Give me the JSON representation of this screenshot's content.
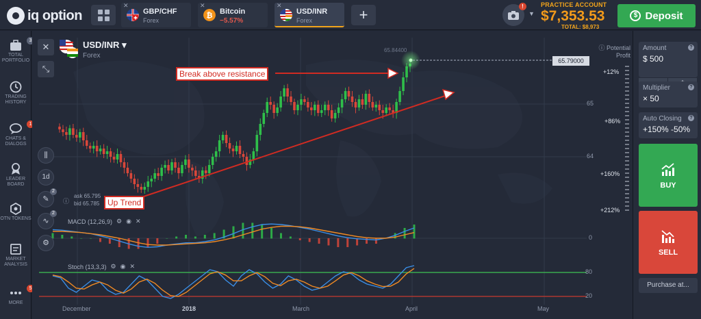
{
  "brand": {
    "name": "iq option"
  },
  "tabs": [
    {
      "name": "GBP/CHF",
      "sub": "Forex"
    },
    {
      "name": "Bitcoin",
      "sub": "−5.57%"
    },
    {
      "name": "USD/INR",
      "sub": "Forex"
    }
  ],
  "account": {
    "label": "PRACTICE ACCOUNT",
    "balance": "$7,353.53",
    "total": "TOTAL: $8,973",
    "notification_badge": "!"
  },
  "deposit_label": "Deposit",
  "sidebar": [
    {
      "label": "TOTAL PORTFOLIO",
      "badge": "3",
      "icon": "portfolio-icon"
    },
    {
      "label": "TRADING HISTORY",
      "badge": "",
      "icon": "history-icon"
    },
    {
      "label": "CHATS & DIALOGS",
      "badge": "1",
      "icon": "chat-icon"
    },
    {
      "label": "LEADER BOARD",
      "badge": "",
      "icon": "leaderboard-icon"
    },
    {
      "label": "OTN TOKENS",
      "badge": "",
      "icon": "token-icon"
    },
    {
      "label": "MARKET ANALYSIS",
      "badge": "",
      "icon": "market-analysis-icon"
    },
    {
      "label": "MORE",
      "badge": "5",
      "icon": "more-icon"
    }
  ],
  "instrument": {
    "pair": "USD/INR",
    "type": "Forex"
  },
  "chart": {
    "potential_profit_label": "Potential Profit",
    "current_price": "65.79000",
    "high_marker": "65.84400",
    "ask": "ask 65.795",
    "bid": "bid 65.785",
    "timeframe": "1d",
    "tool_badges": [
      "2",
      "2"
    ],
    "annotations": [
      "Break above resistance",
      "Up Trend"
    ],
    "macd_label": "MACD (12,26,9)",
    "stoch_label": "Stoch (13,3,3)",
    "price_axis": [
      "65",
      "64"
    ],
    "macd_axis": [
      "0"
    ],
    "stoch_axis": [
      "80",
      "20"
    ],
    "profit_levels": [
      "+12%",
      "+86%",
      "+160%",
      "+212%"
    ],
    "time_axis": [
      "December",
      "2018",
      "March",
      "April",
      "May"
    ]
  },
  "chart_data": {
    "type": "candlestick",
    "ylim": [
      63.4,
      65.9
    ],
    "candles_close": [
      64.6,
      64.55,
      64.5,
      64.62,
      64.5,
      64.45,
      64.55,
      64.4,
      64.3,
      64.25,
      64.3,
      64.2,
      64.25,
      64.15,
      64.2,
      64.1,
      64.05,
      64.15,
      64.0,
      63.9,
      63.8,
      63.7,
      63.6,
      63.55,
      63.5,
      63.55,
      63.65,
      63.7,
      63.8,
      63.75,
      63.9,
      63.95,
      63.85,
      64.0,
      63.9,
      63.8,
      63.95,
      64.05,
      63.9,
      63.85,
      63.75,
      63.7,
      63.85,
      63.8,
      63.95,
      64.1,
      64.2,
      64.4,
      64.5,
      64.35,
      64.25,
      64.2,
      64.3,
      64.15,
      64.1,
      63.95,
      64.05,
      64.2,
      64.5,
      64.7,
      64.9,
      65.1,
      65.05,
      64.9,
      65.0,
      65.2,
      65.35,
      65.2,
      65.1,
      64.95,
      65.05,
      65.15,
      65.1,
      65.0,
      64.95,
      65.05,
      64.9,
      64.95,
      65.05,
      64.95,
      64.8,
      64.9,
      65.0,
      65.15,
      65.3,
      65.2,
      65.1,
      65.0,
      65.15,
      65.05,
      65.25,
      65.1,
      65.0,
      65.05,
      64.95,
      64.9,
      65.0,
      64.95,
      64.9,
      65.1,
      65.3,
      65.55,
      65.75,
      65.8
    ],
    "macd_line": [
      0.15,
      0.14,
      0.12,
      0.1,
      0.08,
      0.04,
      0.0,
      -0.05,
      -0.1,
      -0.14,
      -0.16,
      -0.15,
      -0.12,
      -0.1,
      -0.08,
      -0.08,
      -0.06,
      -0.03,
      0.02,
      0.08,
      0.15,
      0.2,
      0.24,
      0.25,
      0.24,
      0.22,
      0.19,
      0.16,
      0.12,
      0.08,
      0.04,
      0.01,
      -0.01,
      -0.02,
      -0.03,
      0.0,
      0.05,
      0.12,
      0.18
    ],
    "signal_line": [
      0.12,
      0.12,
      0.11,
      0.1,
      0.08,
      0.06,
      0.03,
      0.0,
      -0.04,
      -0.08,
      -0.11,
      -0.12,
      -0.12,
      -0.11,
      -0.1,
      -0.09,
      -0.08,
      -0.06,
      -0.03,
      0.01,
      0.06,
      0.11,
      0.16,
      0.19,
      0.21,
      0.21,
      0.2,
      0.18,
      0.15,
      0.12,
      0.09,
      0.06,
      0.03,
      0.01,
      0.0,
      0.0,
      0.02,
      0.06,
      0.1
    ],
    "stoch_k": [
      70,
      65,
      40,
      30,
      45,
      60,
      55,
      35,
      25,
      30,
      50,
      70,
      60,
      40,
      20,
      15,
      25,
      40,
      55,
      70,
      85,
      80,
      60,
      45,
      70,
      85,
      75,
      55,
      40,
      50,
      70,
      60,
      45,
      35,
      40,
      55,
      70,
      80,
      75,
      60,
      50,
      45,
      40,
      50,
      70,
      90,
      95
    ],
    "stoch_d": [
      72,
      68,
      55,
      40,
      38,
      48,
      55,
      48,
      35,
      28,
      38,
      55,
      62,
      52,
      35,
      22,
      20,
      30,
      45,
      60,
      75,
      80,
      72,
      58,
      58,
      70,
      78,
      68,
      52,
      46,
      58,
      62,
      55,
      45,
      40,
      45,
      58,
      72,
      78,
      70,
      58,
      50,
      44,
      45,
      55,
      75,
      88
    ]
  },
  "right_panel": {
    "amount_label": "Amount",
    "amount_value": "$  500",
    "stepper_minus": "−",
    "stepper_plus": "+",
    "multiplier_label": "Multiplier",
    "multiplier_value": "× 50",
    "auto_closing_label": "Auto Closing",
    "auto_closing_value": "+150%  -50%",
    "buy_label": "BUY",
    "sell_label": "SELL",
    "purchase_label": "Purchase at...",
    "buy_color": "#33a853",
    "sell_color": "#d9473a"
  }
}
